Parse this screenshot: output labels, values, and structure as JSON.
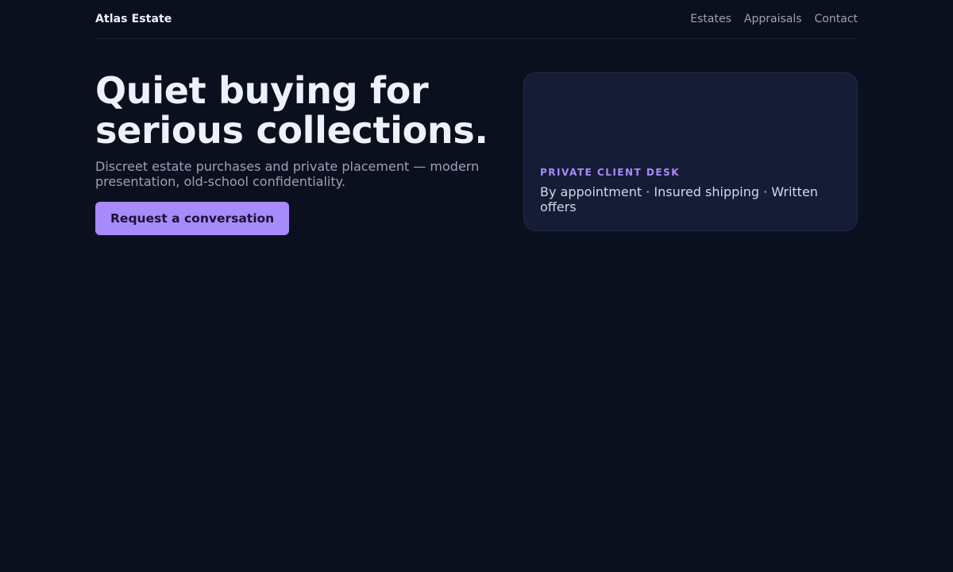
{
  "header": {
    "brand": "Atlas Estate",
    "nav": [
      {
        "label": "Estates"
      },
      {
        "label": "Appraisals"
      },
      {
        "label": "Contact"
      }
    ]
  },
  "hero": {
    "title": "Quiet buying for serious collections.",
    "subtitle": "Discreet estate purchases and private placement — modern presentation, old-school confidentiality.",
    "cta_label": "Request a conversation"
  },
  "card": {
    "eyebrow": "PRIVATE CLIENT DESK",
    "text": "By appointment · Insured shipping · Written offers"
  },
  "colors": {
    "background": "#0b101f",
    "accent": "#a78bfa",
    "card_background": "#151c36"
  }
}
